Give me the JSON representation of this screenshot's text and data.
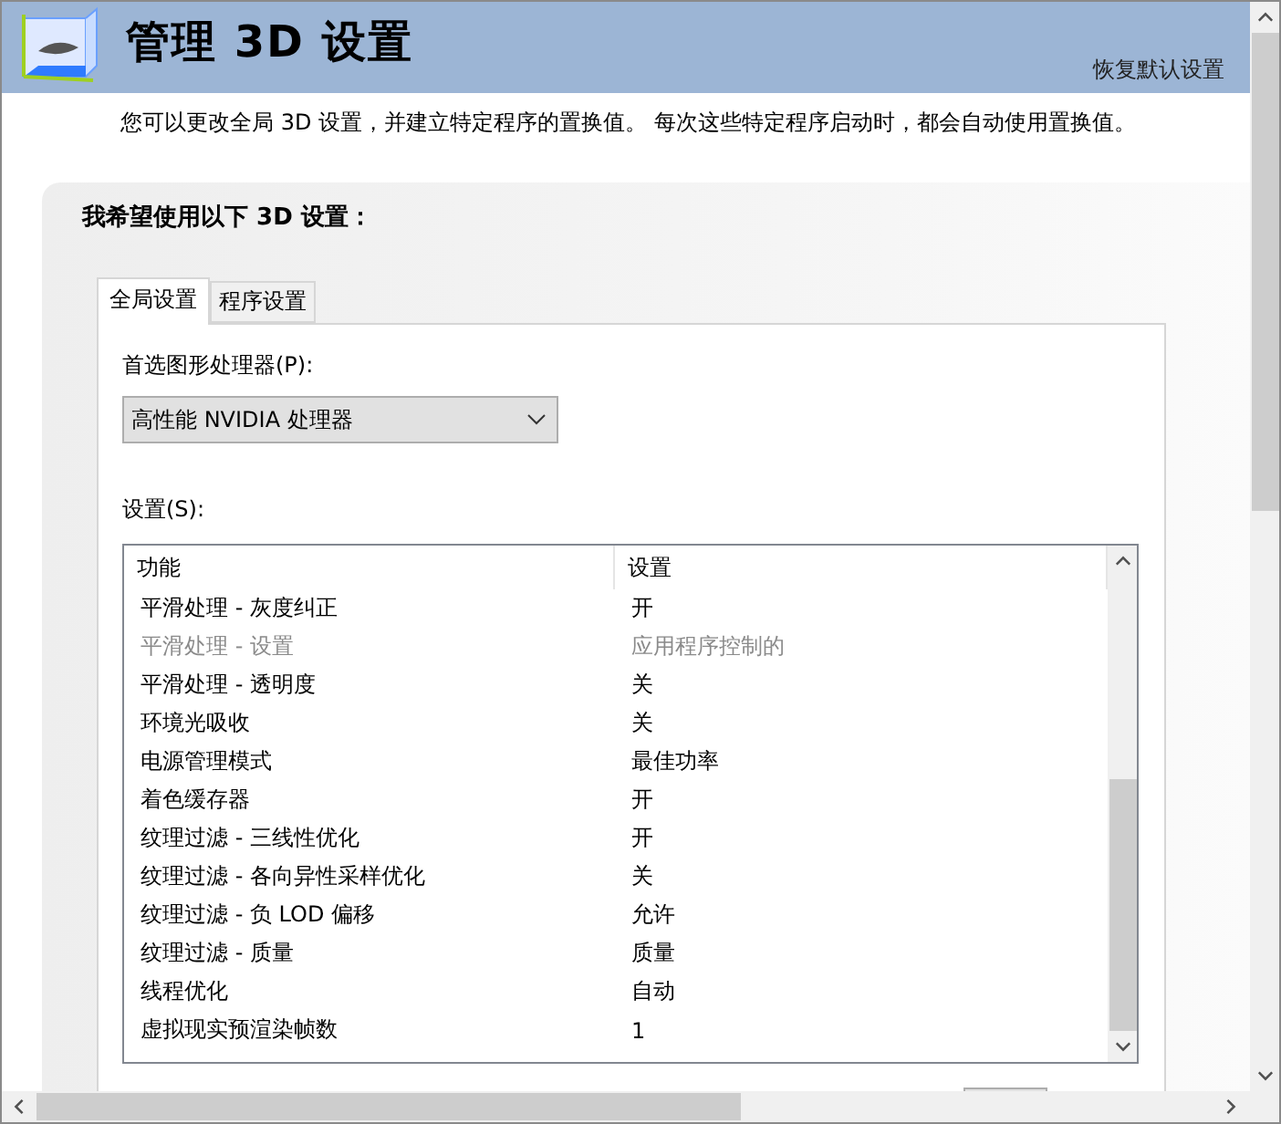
{
  "header": {
    "title": "管理 3D 设置",
    "restore_link": "恢复默认设置"
  },
  "description": "您可以更改全局 3D 设置，并建立特定程序的置换值。 每次这些特定程序启动时，都会自动使用置换值。",
  "panel": {
    "heading": "我希望使用以下 3D 设置："
  },
  "tabs": [
    {
      "label": "全局设置",
      "selected": true
    },
    {
      "label": "程序设置",
      "selected": false
    }
  ],
  "processor": {
    "label": "首选图形处理器(P):",
    "value": "高性能 NVIDIA 处理器"
  },
  "settings": {
    "label": "设置(S):",
    "columns": [
      "功能",
      "设置"
    ],
    "rows": [
      {
        "feature": "平滑处理 - 灰度纠正",
        "value": "开",
        "disabled": false
      },
      {
        "feature": "平滑处理 - 设置",
        "value": "应用程序控制的",
        "disabled": true
      },
      {
        "feature": "平滑处理 - 透明度",
        "value": "关",
        "disabled": false
      },
      {
        "feature": "环境光吸收",
        "value": "关",
        "disabled": false
      },
      {
        "feature": "电源管理模式",
        "value": "最佳功率",
        "disabled": false
      },
      {
        "feature": "着色缓存器",
        "value": "开",
        "disabled": false
      },
      {
        "feature": "纹理过滤 - 三线性优化",
        "value": "开",
        "disabled": false
      },
      {
        "feature": "纹理过滤 - 各向异性采样优化",
        "value": "关",
        "disabled": false
      },
      {
        "feature": "纹理过滤 - 负 LOD 偏移",
        "value": "允许",
        "disabled": false
      },
      {
        "feature": "纹理过滤 - 质量",
        "value": "质量",
        "disabled": false
      },
      {
        "feature": "线程优化",
        "value": "自动",
        "disabled": false
      },
      {
        "feature": "虚拟现实预渲染帧数",
        "value": "1",
        "disabled": false
      }
    ]
  }
}
